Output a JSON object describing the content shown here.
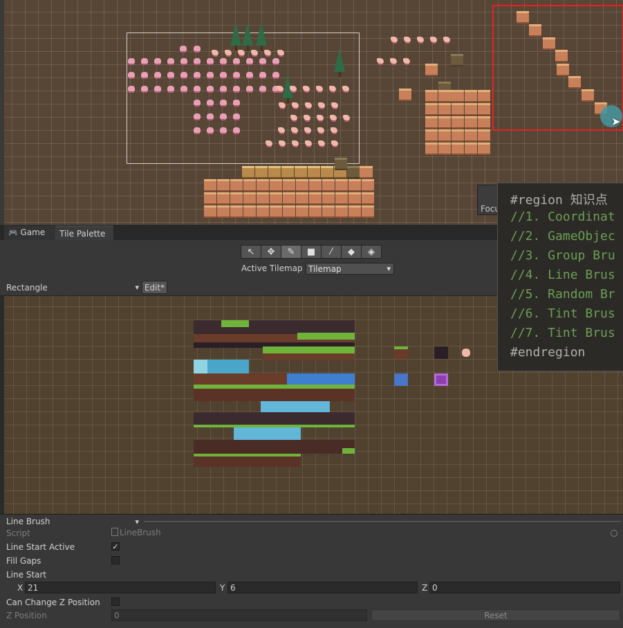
{
  "scene": {
    "focus_label": "Focus"
  },
  "code_overlay": {
    "lines": [
      "#region 知识点",
      "//1. Coordinat",
      "//2. GameObjec",
      "//3. Group Bru",
      "//4. Line Brus",
      "//5. Random Br",
      "//6. Tint Brus",
      "//7. Tint Brus",
      "#endregion"
    ]
  },
  "tabs": {
    "game": "Game",
    "palette": "Tile Palette"
  },
  "toolbar": {
    "tools": [
      "select-icon",
      "move-icon",
      "paint-brush-icon",
      "box-fill-icon",
      "eyedropper-icon",
      "eraser-icon",
      "flood-fill-icon"
    ],
    "active_tilemap_label": "Active Tilemap",
    "active_tilemap_value": "Tilemap"
  },
  "palette": {
    "selected": "Rectangle",
    "edit_label": "Edit*"
  },
  "inspector": {
    "brush": "Line Brush",
    "script_label": "Script",
    "script_value": "LineBrush",
    "line_start_active_label": "Line Start Active",
    "line_start_active": true,
    "fill_gaps_label": "Fill Gaps",
    "fill_gaps": false,
    "line_start_label": "Line Start",
    "x_label": "X",
    "x_value": "21",
    "y_label": "Y",
    "y_value": "6",
    "z_label": "Z",
    "z_value": "0",
    "can_change_z_label": "Can Change Z Position",
    "can_change_z": false,
    "z_position_label": "Z Position",
    "z_position_value": "0",
    "reset_label": "Reset"
  },
  "colors": {
    "scene_bg": "#574535",
    "palette_bg": "#51412f",
    "selection": "#e52222",
    "code_green": "#6a9f55"
  }
}
